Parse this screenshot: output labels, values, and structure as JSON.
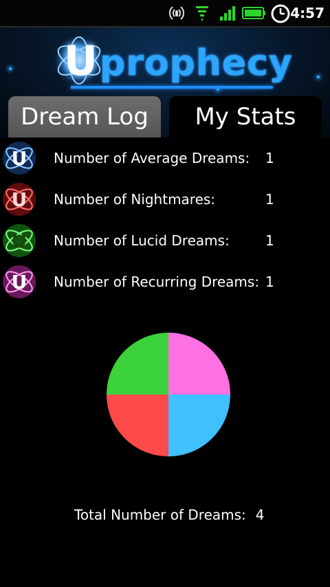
{
  "status_bar": {
    "time": "4:57",
    "icons": [
      "hotspot-icon",
      "wifi-icon",
      "signal-icon",
      "battery-icon",
      "alarm-clock-icon"
    ]
  },
  "header": {
    "logo_letter": "U",
    "logo_text": "prophecy"
  },
  "tabs": [
    {
      "label": "Dream Log",
      "active": false
    },
    {
      "label": "My Stats",
      "active": true
    }
  ],
  "stats": [
    {
      "label": "Number of Average Dreams:",
      "value": "1",
      "color": "#4aa8ff"
    },
    {
      "label": "Number of Nightmares:",
      "value": "1",
      "color": "#ff3a3a"
    },
    {
      "label": "Number of Lucid Dreams:",
      "value": "1",
      "color": "#33dd33"
    },
    {
      "label": "Number of Recurring Dreams:",
      "value": "1",
      "color": "#ff66dd"
    }
  ],
  "chart_data": {
    "type": "pie",
    "slices": [
      {
        "value": 1,
        "color": "#ff70e3"
      },
      {
        "value": 1,
        "color": "#40c0ff"
      },
      {
        "value": 1,
        "color": "#ff4a4a"
      },
      {
        "value": 1,
        "color": "#3cd23c"
      }
    ]
  },
  "total": {
    "label": "Total Number of Dreams:",
    "value": "4"
  }
}
